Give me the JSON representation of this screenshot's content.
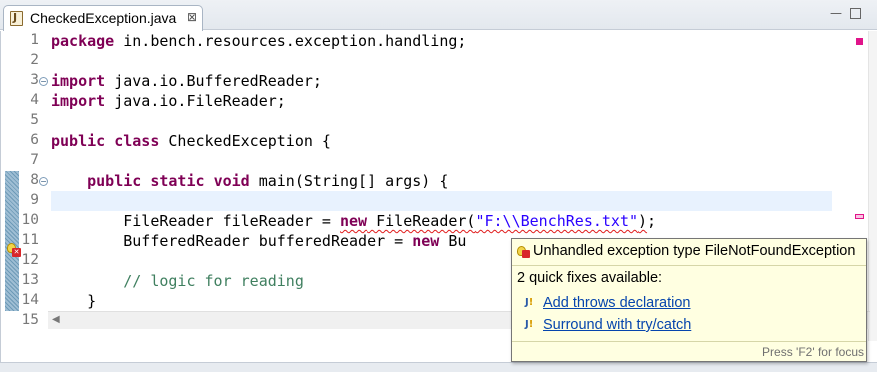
{
  "tab": {
    "title": "CheckedException.java",
    "close_glyph": "⊠",
    "icon": "java-file-icon"
  },
  "window_controls": {
    "minimize": "—",
    "maximize": ""
  },
  "editor": {
    "lines": [
      {
        "no": "1",
        "fold": "",
        "tokens": [
          {
            "t": "kw",
            "v": "package"
          },
          {
            "t": "plain",
            "v": " in.bench.resources.exception.handling;"
          }
        ]
      },
      {
        "no": "2",
        "fold": "",
        "tokens": []
      },
      {
        "no": "3",
        "fold": "⊖",
        "tokens": [
          {
            "t": "kw",
            "v": "import"
          },
          {
            "t": "plain",
            "v": " java.io.BufferedReader;"
          }
        ]
      },
      {
        "no": "4",
        "fold": "",
        "tokens": [
          {
            "t": "kw",
            "v": "import"
          },
          {
            "t": "plain",
            "v": " java.io.FileReader;"
          }
        ]
      },
      {
        "no": "5",
        "fold": "",
        "tokens": []
      },
      {
        "no": "6",
        "fold": "",
        "tokens": [
          {
            "t": "kw",
            "v": "public"
          },
          {
            "t": "plain",
            "v": " "
          },
          {
            "t": "kw",
            "v": "class"
          },
          {
            "t": "plain",
            "v": " CheckedException {"
          }
        ]
      },
      {
        "no": "7",
        "fold": "",
        "tokens": []
      },
      {
        "no": "8",
        "fold": "⊖",
        "tokens": [
          {
            "t": "plain",
            "v": "    "
          },
          {
            "t": "kw",
            "v": "public"
          },
          {
            "t": "plain",
            "v": " "
          },
          {
            "t": "kw",
            "v": "static"
          },
          {
            "t": "plain",
            "v": " "
          },
          {
            "t": "kw",
            "v": "void"
          },
          {
            "t": "plain",
            "v": " main(String[] args) {"
          }
        ]
      },
      {
        "no": "9",
        "fold": "",
        "tokens": []
      },
      {
        "no": "10",
        "fold": "",
        "tokens": [
          {
            "t": "plain",
            "v": "        FileReader fileReader = "
          },
          {
            "t": "kw-err",
            "v": "new"
          },
          {
            "t": "err",
            "v": " FileReader("
          },
          {
            "t": "str-err",
            "v": "\"F:\\\\BenchRes.txt\""
          },
          {
            "t": "err",
            "v": ")"
          },
          {
            "t": "plain",
            "v": ";"
          }
        ]
      },
      {
        "no": "11",
        "fold": "",
        "tokens": [
          {
            "t": "plain",
            "v": "        BufferedReader bufferedReader = "
          },
          {
            "t": "kw",
            "v": "new"
          },
          {
            "t": "plain",
            "v": " Bu"
          }
        ]
      },
      {
        "no": "12",
        "fold": "",
        "tokens": []
      },
      {
        "no": "13",
        "fold": "",
        "tokens": [
          {
            "t": "plain",
            "v": "        "
          },
          {
            "t": "cmt",
            "v": "// logic for reading"
          }
        ]
      },
      {
        "no": "14",
        "fold": "",
        "tokens": [
          {
            "t": "plain",
            "v": "    }"
          }
        ]
      },
      {
        "no": "15",
        "fold": "",
        "tokens": [
          {
            "t": "plain",
            "v": "}"
          }
        ]
      }
    ],
    "current_line": 9
  },
  "hover": {
    "title": "Unhandled exception type FileNotFoundException",
    "count_text": "2 quick fixes available:",
    "fixes": [
      {
        "label": "Add throws declaration"
      },
      {
        "label": "Surround with try/catch"
      }
    ],
    "footer": "Press 'F2' for focus"
  },
  "colors": {
    "keyword": "#7f0055",
    "string": "#2a00ff",
    "comment": "#3f7f5f",
    "error": "#e01b1b",
    "current_line": "#e8f2fe",
    "hover_bg": "#ffffe1",
    "link": "#0645ad"
  }
}
